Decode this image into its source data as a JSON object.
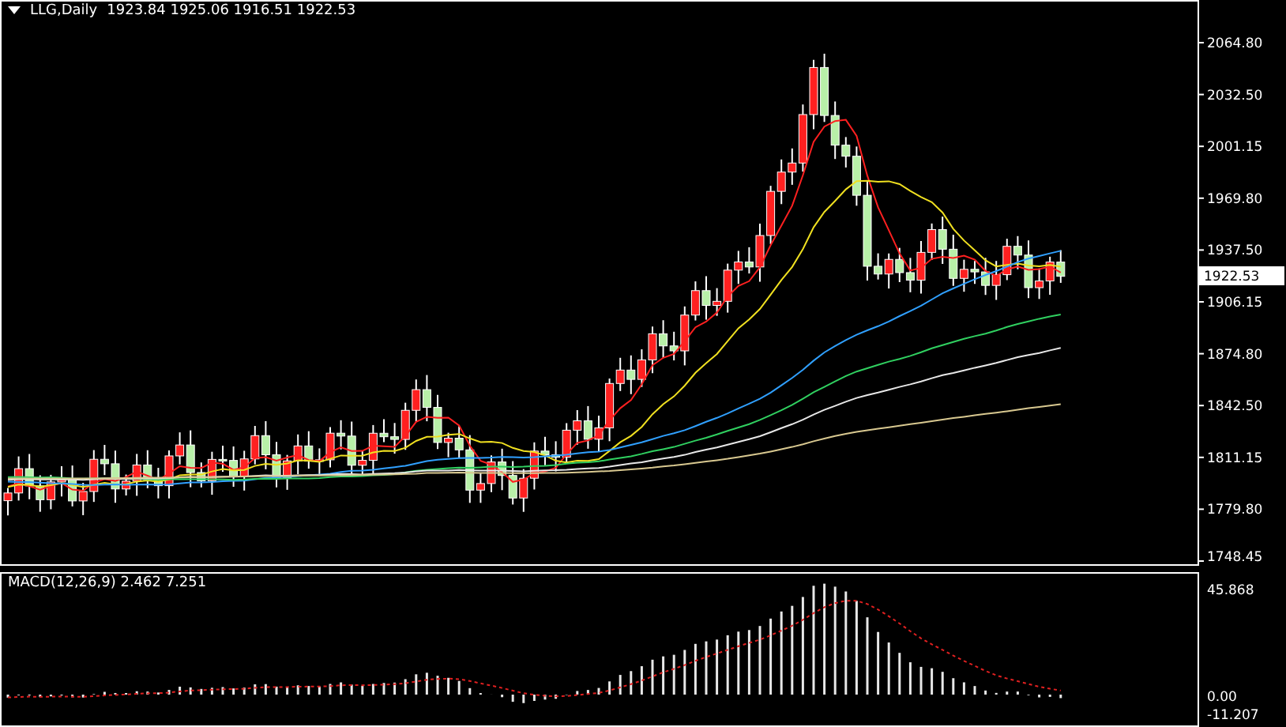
{
  "header": {
    "symbol": "LLG,Daily",
    "ohlc": "1923.84 1925.06 1916.51 1922.53"
  },
  "price_axis": {
    "ticks": [
      "2064.80",
      "2032.50",
      "2001.15",
      "1969.80",
      "1937.50",
      "1906.15",
      "1874.80",
      "1842.50",
      "1811.15",
      "1779.80",
      "1748.45"
    ],
    "current_price": "1922.53"
  },
  "macd": {
    "label": "MACD(12,26,9) 2.462 7.251",
    "ticks": [
      "45.868",
      "0.00",
      "-11.207"
    ]
  }
}
